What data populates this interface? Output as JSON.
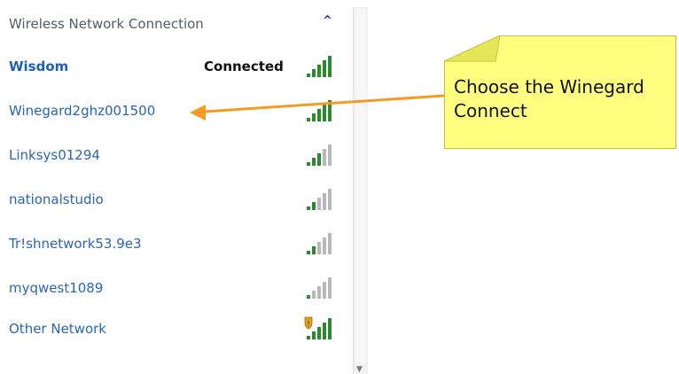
{
  "panel": {
    "header": "Wireless Network Connection",
    "collapse_icon": "chevron-up-icon",
    "networks": [
      {
        "name": "Wisdom",
        "status": "Connected",
        "signal_bars": 5,
        "secured": false
      },
      {
        "name": "Winegard2ghz001500",
        "status": "",
        "signal_bars": 5,
        "secured": false
      },
      {
        "name": "Linksys01294",
        "status": "",
        "signal_bars": 3,
        "secured": false
      },
      {
        "name": "nationalstudio",
        "status": "",
        "signal_bars": 2,
        "secured": false
      },
      {
        "name": "Tr!shnetwork53.9e3",
        "status": "",
        "signal_bars": 2,
        "secured": false
      },
      {
        "name": "myqwest1089",
        "status": "",
        "signal_bars": 1,
        "secured": false
      },
      {
        "name": "Other Network",
        "status": "",
        "signal_bars": 5,
        "secured": true
      }
    ]
  },
  "callout": {
    "text_line1": "Choose the Winegard",
    "text_line2": "Connect"
  },
  "colors": {
    "link_blue": "#2a66b5",
    "signal_green": "#2b8a2e",
    "signal_gray": "#b8b8b8",
    "note_yellow": "#ffff80",
    "arrow_orange": "#f59a23"
  }
}
